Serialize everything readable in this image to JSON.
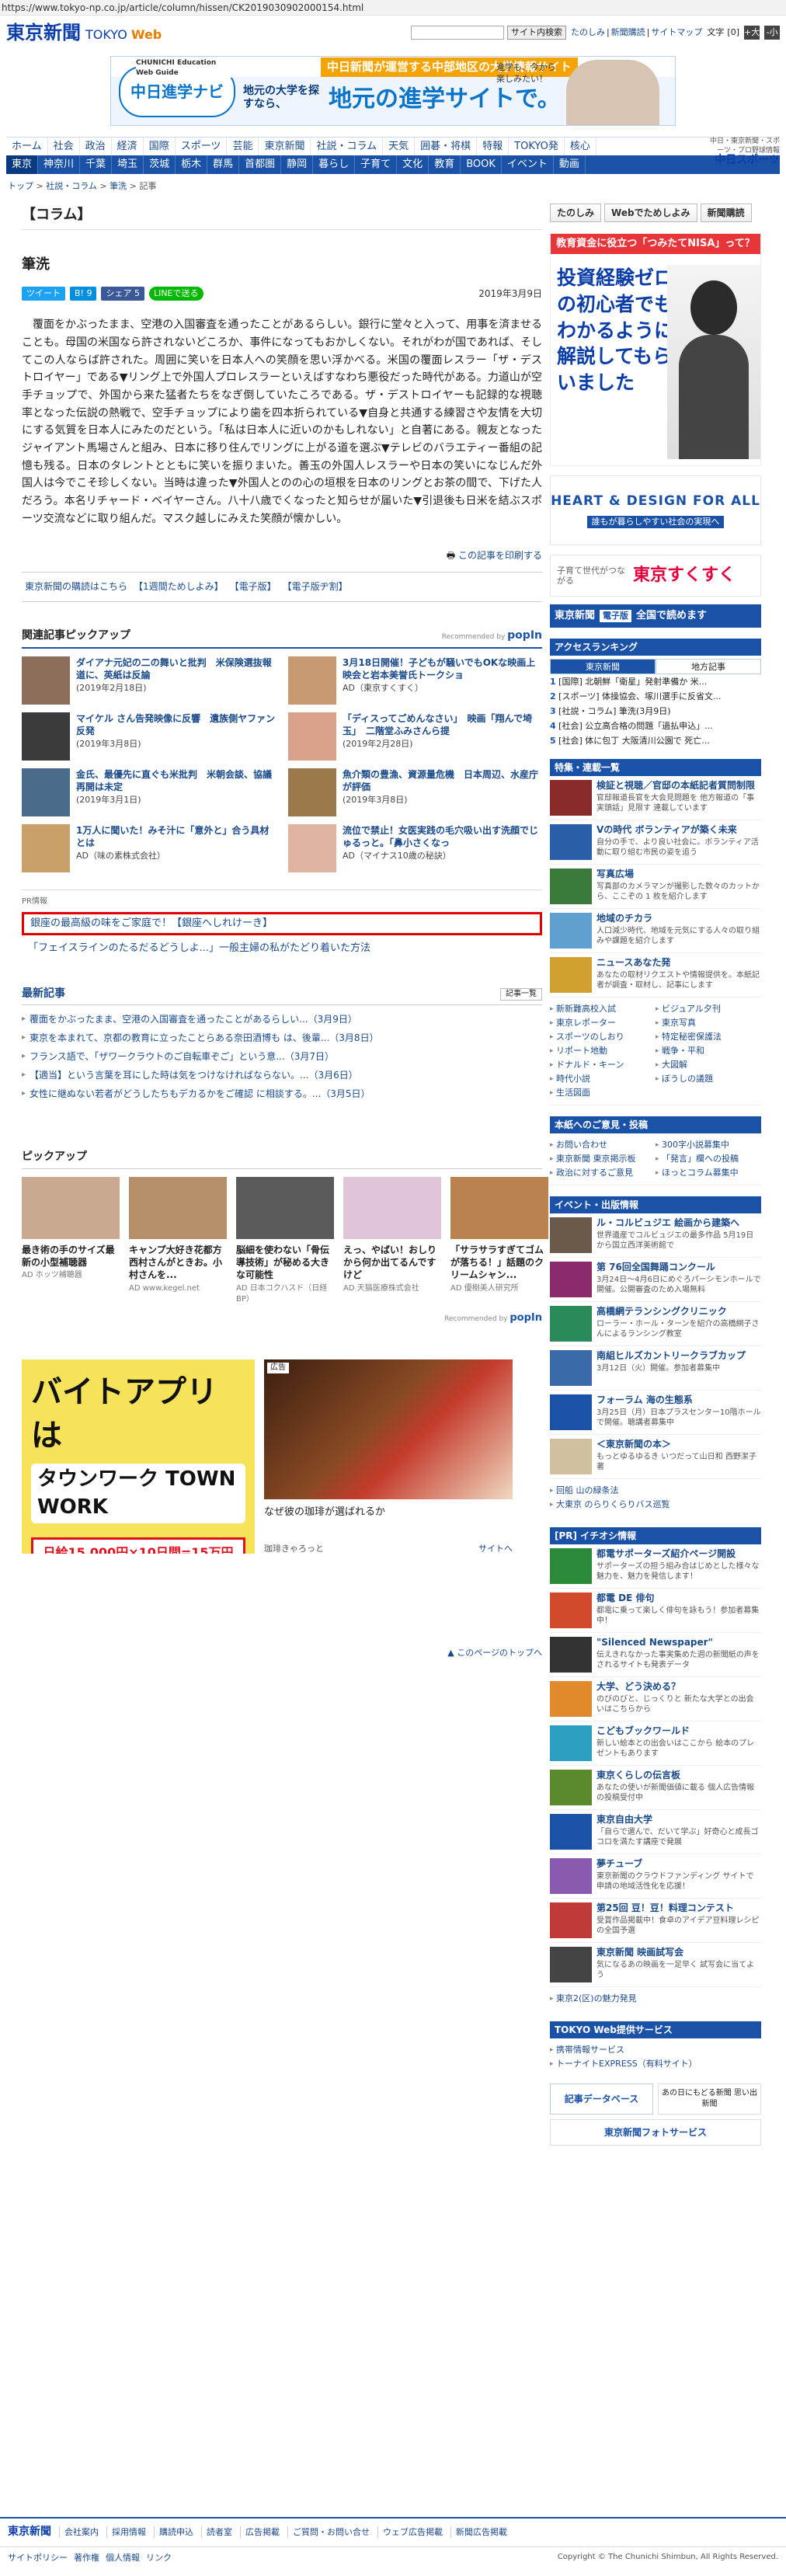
{
  "browser": {
    "url": "https://www.tokyo-np.co.jp/article/column/hissen/CK2019030902000154.html"
  },
  "header": {
    "logo_ja": "東京新聞",
    "logo_en": "TOKYO",
    "logo_web": "Web",
    "search_btn": "サイト内検索",
    "links": [
      "たのしみ",
      "新聞購読",
      "サイトマップ"
    ],
    "font_label": "文字",
    "font_size": "[0]",
    "font_up": "+大",
    "font_down": "-小"
  },
  "banner": {
    "tag": "中日新聞が運営する中部地区の大学情報サイト",
    "logo": "中日進学ナビ",
    "logo_sub": "CHUNICHI Education Web Guide",
    "copy1": "地元の大学を探すなら、",
    "copy2": "地元の進学サイトで。",
    "note": "進学も、今から楽しみたい！"
  },
  "nav1": [
    "ホーム",
    "社会",
    "政治",
    "経済",
    "国際",
    "スポーツ",
    "芸能",
    "東京新聞",
    "社説・コラム",
    "天気",
    "囲碁・将棋",
    "特報",
    "TOKYO発",
    "核心"
  ],
  "nav2": [
    "東京",
    "神奈川",
    "千葉",
    "埼玉",
    "茨城",
    "栃木",
    "群馬",
    "首都圏",
    "静岡",
    "暮らし",
    "子育て",
    "文化",
    "教育",
    "BOOK",
    "イベント",
    "動画"
  ],
  "chunichi": {
    "lines": "中日・東京新聞・スポーツ・プロ野球情報",
    "brand": "中日スポーツ"
  },
  "breadcrumb": [
    "トップ",
    "社説・コラム",
    "筆洗",
    "記事"
  ],
  "article": {
    "category": "【コラム】",
    "title": "筆洗",
    "share": {
      "tweet": "ツイート",
      "hatena": "B! 9",
      "facebook": "シェア 5",
      "line": "LINEで送る"
    },
    "date": "2019年3月9日",
    "body": "覆面をかぶったまま、空港の入国審査を通ったことがあるらしい。銀行に堂々と入って、用事を済ませることも。母国の米国なら許されないどころか、事件になってもおかしくない。それがわが国であれば、そしてこの人ならば許された。周囲に笑いを日本人への笑顔を思い浮かべる。米国の覆面レスラー「ザ・デストロイヤー」である▼リング上で外国人プロレスラーといえばすなわち悪役だった時代がある。力道山が空手チョップで、外国から来た猛者たちをなぎ倒していたころである。ザ・デストロイヤーも記録的な視聴率となった伝説の熱戦で、空手チョップにより歯を四本折られている▼自身と共通する練習さや友情を大切にする気質を日本人にみたのだという。「私は日本人に近いのかもしれない」と自著にある。親友となったジャイアント馬場さんと組み、日本に移り住んでリングに上がる道を選ぶ▼テレビのバラエティー番組の記憶も残る。日本のタレントとともに笑いを振りまいた。善玉の外国人レスラーや日本の笑いになじんだ外国人は今でこそ珍しくない。当時は違った▼外国人とのの心の垣根を日本のリングとお茶の間で、下げた人だろう。本名リチャード・ベイヤーさん。八十八歳でくなったと知らせが届いた▼引退後も日米を結ぶスポーツ交流などに取り組んだ。マスク越しにみえた笑顔が懐かしい。",
    "print": "この記事を印刷する",
    "links": [
      "東京新聞の購読はこちら",
      "【1週間ためしよみ】",
      "【電子版】",
      "【電子版ヂ割】"
    ]
  },
  "pickup": {
    "heading": "関連記事ピックアップ",
    "rec": "Recommended by",
    "brand": "popIn",
    "items": [
      {
        "title": "ダイアナ元妃の二の舞いと批判　米保険選抜報道に、英紙は反論",
        "date": "(2019年2月18日)"
      },
      {
        "title": "3月18日開催！子どもが騒いでもOKな映画上映会と岩本美誉氏トークショ",
        "date": "AD（東京すくすく）"
      },
      {
        "title": "マイケル さん告発映像に反響　遺族側ヤファン反発",
        "date": "(2019年3月8日)"
      },
      {
        "title": "「ディスってごめんなさい」　映画「翔んで埼玉」　二階堂ふみさんら提",
        "date": "(2019年2月28日)"
      },
      {
        "title": "金氏、最優先に直ぐも米批判　米朝会談、協議再開は未定",
        "date": "(2019年3月1日)"
      },
      {
        "title": "魚介類の豊漁、資源量危機　日本周辺、水産庁が評価",
        "date": "(2019年3月8日)"
      },
      {
        "title": "1万人に聞いた！みそ汁に「意外と」合う具材とは",
        "date": "AD（味の素株式会社）"
      },
      {
        "title": "流位で禁止！女医実践の毛穴吸い出す洗顔でじゅるっと。「鼻小さくなっ",
        "date": "AD（マイナス10歳の秘訣）"
      }
    ]
  },
  "pr": {
    "label": "PR情報",
    "box": "銀座の最高級の味をご家庭で！【銀座へしれけーき】",
    "line2": "「フェイスラインのたるだるどうしよ...」一般主婦の私がたどり着いた方法"
  },
  "latest": {
    "heading": "最新記事",
    "more": "記事一覧",
    "items": [
      "覆面をかぶったまま、空港の入国審査を通ったことがあるらしい...（3月9日）",
      "東京を本まれて、京都の教育に立ったことらある奈田酒博も は、後輩...（3月8日）",
      "フランス語で、「ザワークラウトのご自転車ぞご」という意...（3月7日）",
      "【適当】という言葉を耳にした時は気をつけなければならない。...（3月6日）",
      "女性に継ぬない若者がどうしたちもデカるかをご確認 に相談する。...（3月5日）"
    ]
  },
  "pickup2": {
    "heading": "ピックアップ",
    "items": [
      {
        "title": "最き術の手のサイズ最新の小型補聴器",
        "src": "AD ホッツ補聴器"
      },
      {
        "title": "キャンプ大好き花都方西村さんがときお。小村さんを...",
        "src": "AD www.kegel.net"
      },
      {
        "title": "脳細を使わない「骨伝導技術」が秘める大きな可能性",
        "src": "AD 日本コクハスド（日経BP）"
      },
      {
        "title": "えっ、やばい！おしりから何か出てるんですけど",
        "src": "AD 天猫医療株式会社"
      },
      {
        "title": "「サラサラすぎてゴムが落ちる！」話題のクリームシャン...",
        "src": "AD 優樹美人研究所"
      }
    ],
    "rec": "Recommended by",
    "brand": "popIn"
  },
  "ads": {
    "ad1": {
      "h": "バイトアプリは",
      "brand": "タウンワーク TOWN WORK",
      "pay": "日給15,000円×10日間=15万円"
    },
    "ad2": {
      "tag": "広告",
      "title": "なぜ彼の珈琲が選ばれるか",
      "source": "珈琲きゃろっと",
      "more": "サイトへ"
    }
  },
  "totop": "このページのトップへ",
  "side": {
    "btns": [
      "たのしみ",
      "Webでためしよみ",
      "新聞購読"
    ],
    "ad1": {
      "hd": "教育資金に役立つ「つみたてNISA」って？",
      "big": "投資経験ゼロの初心者でもわかるように解説してもらいました"
    },
    "ad2": {
      "t": "HEART & DESIGN FOR ALL",
      "s": "誰もが暮らしやすい社会の実現へ"
    },
    "ad3": {
      "a": "子育て世代がつながる",
      "b": "東京すくすく"
    },
    "ad4": {
      "brand": "東京新聞",
      "tag": "電子版",
      "text": "全国で読めます"
    },
    "ranking": {
      "heading": "アクセスランキング",
      "tabs": [
        "東京新聞",
        "地方記事"
      ],
      "items": [
        {
          "no": "1",
          "text": "[国際] 北朝鮮「衛星」発射準備か  米..."
        },
        {
          "no": "2",
          "text": "[スポーツ] 体操協会、塚川選手に反省文..."
        },
        {
          "no": "3",
          "text": "[社説・コラム] 筆洗(3月9日)"
        },
        {
          "no": "4",
          "text": "[社会] 公立高合格の問題「過払申込」..."
        },
        {
          "no": "5",
          "text": "[社会] 体に包丁  大阪清川公園で  死亡..."
        }
      ]
    },
    "special": {
      "heading": "特集・連載一覧",
      "items": [
        {
          "title": "検証と視聴／官邸の本紙記者質問制限",
          "desc": "官邸報道長官を大会見問題を 他方報道の「事実頭話」見限す 連載しています"
        },
        {
          "title": "Vの時代 ボランティアが築く未来",
          "desc": "自分の手で、より良い社会に。ボランティア活動に取り組む市民の姿を追う"
        },
        {
          "title": "写真広場",
          "desc": "写真部のカメラマンが撮影した数々のカットから、ここぞの 1 枚を紹介します"
        },
        {
          "title": "地域のチカラ",
          "desc": "人口減少時代、地域を元気にする人々の取り組みや課題を紹介します"
        },
        {
          "title": "ニュースあなた発",
          "desc": "あなたの取材リクエストや情報提供を。本紙記者が調査・取材し、記事にします"
        }
      ],
      "grid": [
        "新新難高校入試",
        "ビジュアル夕刊",
        "東京レポーター",
        "東京写真",
        "スポーツのしおり",
        "特定秘密保護法",
        "リポート地動",
        "戦争・平和",
        "ドナルド・キーン",
        "大図解",
        "時代小説",
        "ぼうしの議題",
        "生活図面"
      ]
    },
    "inquiry": {
      "heading": "本紙へのご意見・投稿",
      "items": [
        "お問い合わせ",
        "300字小説募集中",
        "東京新聞  東京掲示板",
        "「発言」欄への投稿",
        "政治に対するご意見",
        "ほっとコラム募集中"
      ]
    },
    "event": {
      "heading": "イベント・出版情報",
      "items": [
        {
          "title": "ル・コルビュジエ  絵画から建築へ",
          "desc": "世界遺産でコルビュジエの最多作品  5月19日から国立西洋美術館で"
        },
        {
          "title": "第 76回全国舞踊コンクール",
          "desc": "3月24日〜4月6日にめぐろパーシモンホールで開催。公開審査のため入場無料"
        },
        {
          "title": "高橋網テランシングクリニック",
          "desc": "ローラー・ホール・ターンを紹介の高橋網子さんによるランシング教室"
        },
        {
          "title": "南組ヒルズカントリークラブカップ",
          "desc": "3月12日（火）開催。参加者募集中"
        },
        {
          "title": "フォーラム  海の生態系",
          "desc": "3月25日（月）日本プラスセンター10階ホールで開催。聴講者募集中"
        },
        {
          "title": "＜東京新聞の本＞",
          "desc": "もっとゆるゆるき いつだって山日和  西野潔子  著"
        }
      ],
      "extra": [
        "回船  山の緑条法",
        "大東京  のらりくらりバス巡覧"
      ]
    },
    "prinfo": {
      "heading": "[PR] イチオシ情報",
      "items": [
        {
          "title": "都電サポーターズ紹介ページ開設",
          "desc": "サポーターズの担う組み合はじめとした様々な魅力を、魅力を発信します！"
        },
        {
          "title": "都電 DE 俳句",
          "desc": "都電に乗って楽しく俳句を詠もう！参加者募集中！"
        },
        {
          "title": "\"Silenced Newspaper\"",
          "desc": "伝えきれなかった事実集めた週の新聞紙の声をされるサイトも発表データ"
        },
        {
          "title": "大学、どう決める？",
          "desc": "のびのびと、じっくりと 新たな大学との出会いはこちらから"
        },
        {
          "title": "こどもブックワールド",
          "desc": "新しい絵本との出会いはここから  絵本のプレゼントもあります"
        },
        {
          "title": "東京くらしの伝言板",
          "desc": "あなたの使いが新聞価値に載る  個人広告情報の投稿受付中"
        },
        {
          "title": "東京自由大学",
          "desc": "「自らで選んで、だいて学ぶ」好奇心と成長ゴコロを満たす講座で発展"
        },
        {
          "title": "夢チューブ",
          "desc": "東京新聞のクラウドファンディング  サイトで申請の地域活性化を応援！"
        },
        {
          "title": "第25回  豆！豆！料理コンテスト",
          "desc": "受賞作品掲載中！食卓のアイデア豆料理レシピの全国予選"
        },
        {
          "title": "東京新聞 映画試写会",
          "desc": "気になるあの映画を一足早く  試写会に当てよう"
        }
      ],
      "extra": "東京2(区)の魅力発見"
    },
    "service": {
      "heading": "TOKYO Web提供サービス",
      "items": [
        "携帯情報サービス",
        "トーナイトEXPRESS（有料サイト）"
      ]
    },
    "bottom": {
      "a": "記事データベース",
      "b": "あの日にもどる新聞  思い出新聞",
      "c": "東京新聞フォトサービス"
    }
  },
  "footer": {
    "logo": "東京新聞",
    "links": [
      "会社案内",
      "採用情報",
      "購読申込",
      "読者室",
      "広告掲載",
      "ご質問・お問い合せ",
      "ウェブ広告掲載",
      "新聞広告掲載"
    ],
    "links2": [
      "サイトポリシー",
      "著作権",
      "個人情報",
      "リンク"
    ],
    "copyright": "Copyright © The Chunichi Shimbun, All Rights Reserved."
  },
  "colors": {
    "brand": "#1a52a8",
    "accent": "#e00000"
  }
}
